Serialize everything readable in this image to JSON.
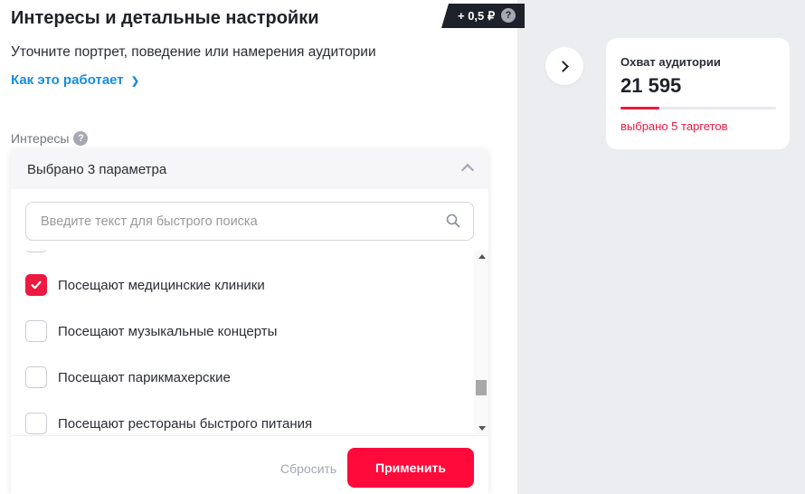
{
  "header": {
    "title": "Интересы и детальные настройки",
    "price_badge": "+ 0,5 ₽",
    "price_help": "?",
    "subtitle": "Уточните портрет, поведение или намерения аудитории",
    "how_link": "Как это работает",
    "how_link_chevron": "❯"
  },
  "interests": {
    "label": "Интересы",
    "help": "?",
    "selected_text": "Выбрано 3 параметра",
    "search_placeholder": "Введите текст для быстрого поиска",
    "items": [
      {
        "label": "Посещают медицинские клиники",
        "checked": true
      },
      {
        "label": "Посещают музыкальные концерты",
        "checked": false
      },
      {
        "label": "Посещают парикмахерские",
        "checked": false
      },
      {
        "label": "Посещают рестораны быстрого питания",
        "checked": false
      }
    ],
    "reset_label": "Сбросить",
    "apply_label": "Применить"
  },
  "reach": {
    "title": "Охват аудитории",
    "value": "21 595",
    "selected_text": "выбрано 5 таргетов",
    "progress_fraction": 0.25
  },
  "colors": {
    "accent": "#ff0a3b",
    "link": "#1a8ce0",
    "background": "#ebedf1"
  },
  "icons": {
    "search": "search-icon",
    "next": "chevron-right-icon",
    "collapse": "chevron-up-icon",
    "check": "check-icon"
  }
}
